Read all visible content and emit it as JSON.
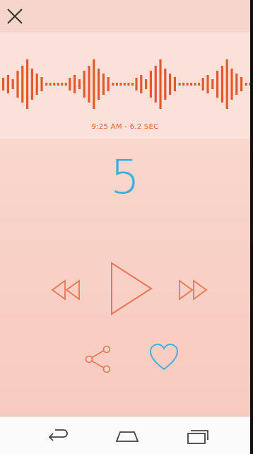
{
  "header": {
    "close_icon": "close-icon"
  },
  "recording": {
    "caption": "9:25 AM - 6.2 SEC",
    "wave_color": "#e25a2c"
  },
  "counter": {
    "value": "5",
    "color": "#3aaee0"
  },
  "controls": {
    "rewind_icon": "rewind-icon",
    "play_icon": "play-icon",
    "forward_icon": "fast-forward-icon"
  },
  "actions": {
    "share_icon": "share-icon",
    "like_icon": "heart-icon",
    "like_color": "#3aaee0"
  },
  "navbar": {
    "back_icon": "back-icon",
    "home_icon": "home-icon",
    "recent_icon": "recent-apps-icon"
  }
}
